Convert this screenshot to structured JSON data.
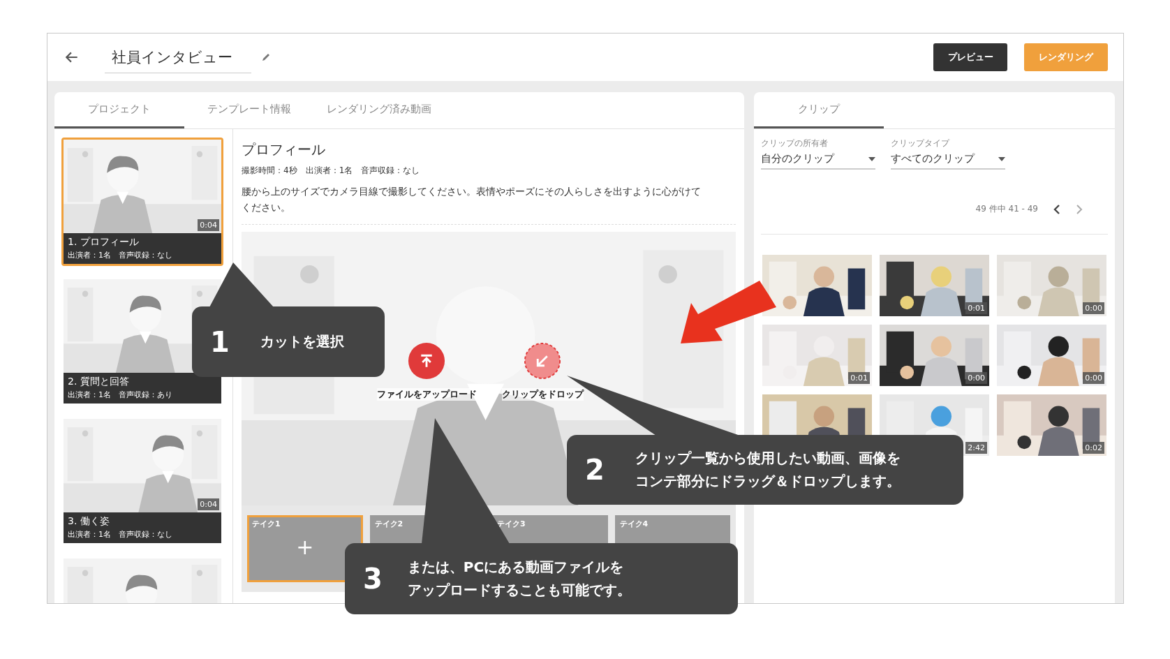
{
  "header": {
    "title": "社員インタビュー",
    "buttons": [
      {
        "kind": "dark",
        "label": "プレビュー"
      },
      {
        "kind": "accent",
        "label": "レンダリング"
      }
    ]
  },
  "project_tabs": [
    {
      "label": "プロジェクト",
      "selected": true
    },
    {
      "label": "テンプレート情報",
      "selected": false
    },
    {
      "label": "レンダリング済み動画",
      "selected": false
    }
  ],
  "scenes": [
    {
      "title": "1. プロフィール",
      "meta": "出演者：1名　音声収録：なし",
      "duration": "0:04",
      "selected": true
    },
    {
      "title": "2. 質問と回答",
      "meta": "出演者：1名　音声収録：あり",
      "selected": false
    },
    {
      "title": "3. 働く姿",
      "meta": "出演者：1名　音声収録：なし",
      "duration": "0:04",
      "selected": false
    },
    {
      "selected": false
    }
  ],
  "scene_detail": {
    "title": "プロフィール",
    "meta": "撮影時間：4秒　出演者：1名　音声収録：なし",
    "description": "腰から上のサイズでカメラ目線で撮影してください。表情やポーズにその人らしさを出すように心がけてください。"
  },
  "drop_actions": [
    {
      "kind": "upload",
      "label": "ファイルをアップロード"
    },
    {
      "kind": "drop",
      "label": "クリップをドロップ"
    }
  ],
  "takes": [
    {
      "label": "テイク1",
      "selected": true,
      "add": "+"
    },
    {
      "label": "テイク2",
      "selected": false
    },
    {
      "label": "テイク3",
      "selected": false
    },
    {
      "label": "テイク4",
      "selected": false
    }
  ],
  "clip_panel": {
    "tabs": [
      {
        "label": "クリップ",
        "selected": true
      }
    ],
    "filters": [
      {
        "label": "クリップの所有者",
        "value": "自分のクリップ"
      },
      {
        "label": "クリップタイプ",
        "value": "すべてのクリップ"
      }
    ],
    "pagination": "49 件中 41 - 49",
    "clips": [
      {
        "kind": "picture"
      },
      {
        "kind": "picture",
        "duration": "0:01"
      },
      {
        "kind": "picture",
        "duration": "0:00"
      },
      {
        "kind": "picture",
        "duration": "0:01"
      },
      {
        "kind": "picture",
        "duration": "0:00"
      },
      {
        "kind": "picture",
        "duration": "0:00"
      },
      {
        "kind": "picture"
      },
      {
        "kind": "picture",
        "duration": "2:42"
      },
      {
        "kind": "picture",
        "duration": "0:02"
      }
    ]
  },
  "callouts": [
    {
      "number": "1",
      "lines": [
        "カットを選択"
      ]
    },
    {
      "number": "2",
      "lines": [
        "クリップ一覧から使用したい動画、画像を",
        "コンテ部分にドラッグ＆ドロップします。"
      ]
    },
    {
      "number": "3",
      "lines": [
        "または、PCにある動画ファイルを",
        "アップロードすることも可能です。"
      ]
    }
  ]
}
